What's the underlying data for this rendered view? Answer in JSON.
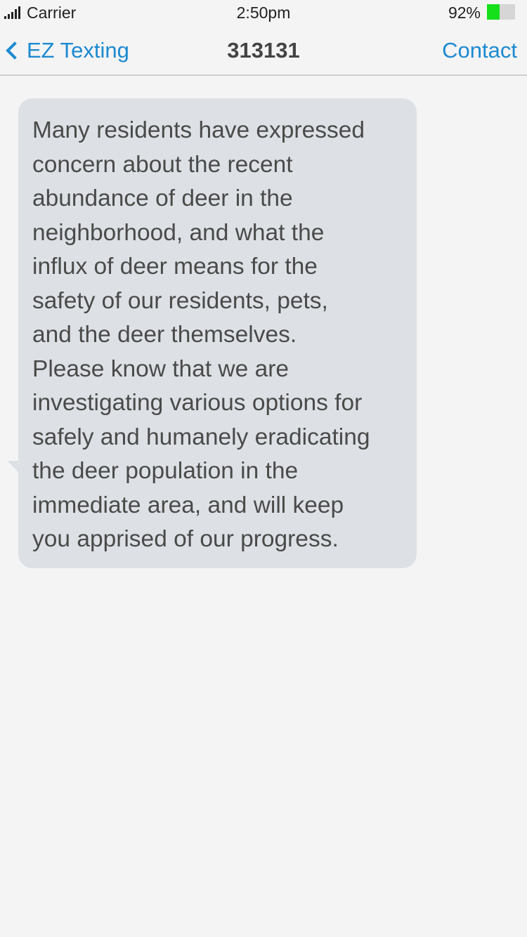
{
  "status_bar": {
    "carrier": "Carrier",
    "time": "2:50pm",
    "battery_percent": "92%",
    "battery_level": 0.46,
    "battery_color": "#16e01a",
    "signal_icon": "signal-bars-icon"
  },
  "nav": {
    "back_label": "EZ Texting",
    "back_icon": "chevron-left-icon",
    "title": "313131",
    "contact_label": "Contact",
    "accent_color": "#1c8ad0"
  },
  "messages": [
    {
      "direction": "incoming",
      "text": "Many residents have expressed\nconcern about the recent\nabundance of deer in the\nneighborhood, and what the\ninflux of deer means for the\nsafety of our residents, pets,\nand the deer themselves.\nPlease know that we are\ninvestigating various options for\nsafely and humanely eradicating\nthe deer population in the\nimmediate area, and will keep\nyou apprised of our progress."
    }
  ]
}
